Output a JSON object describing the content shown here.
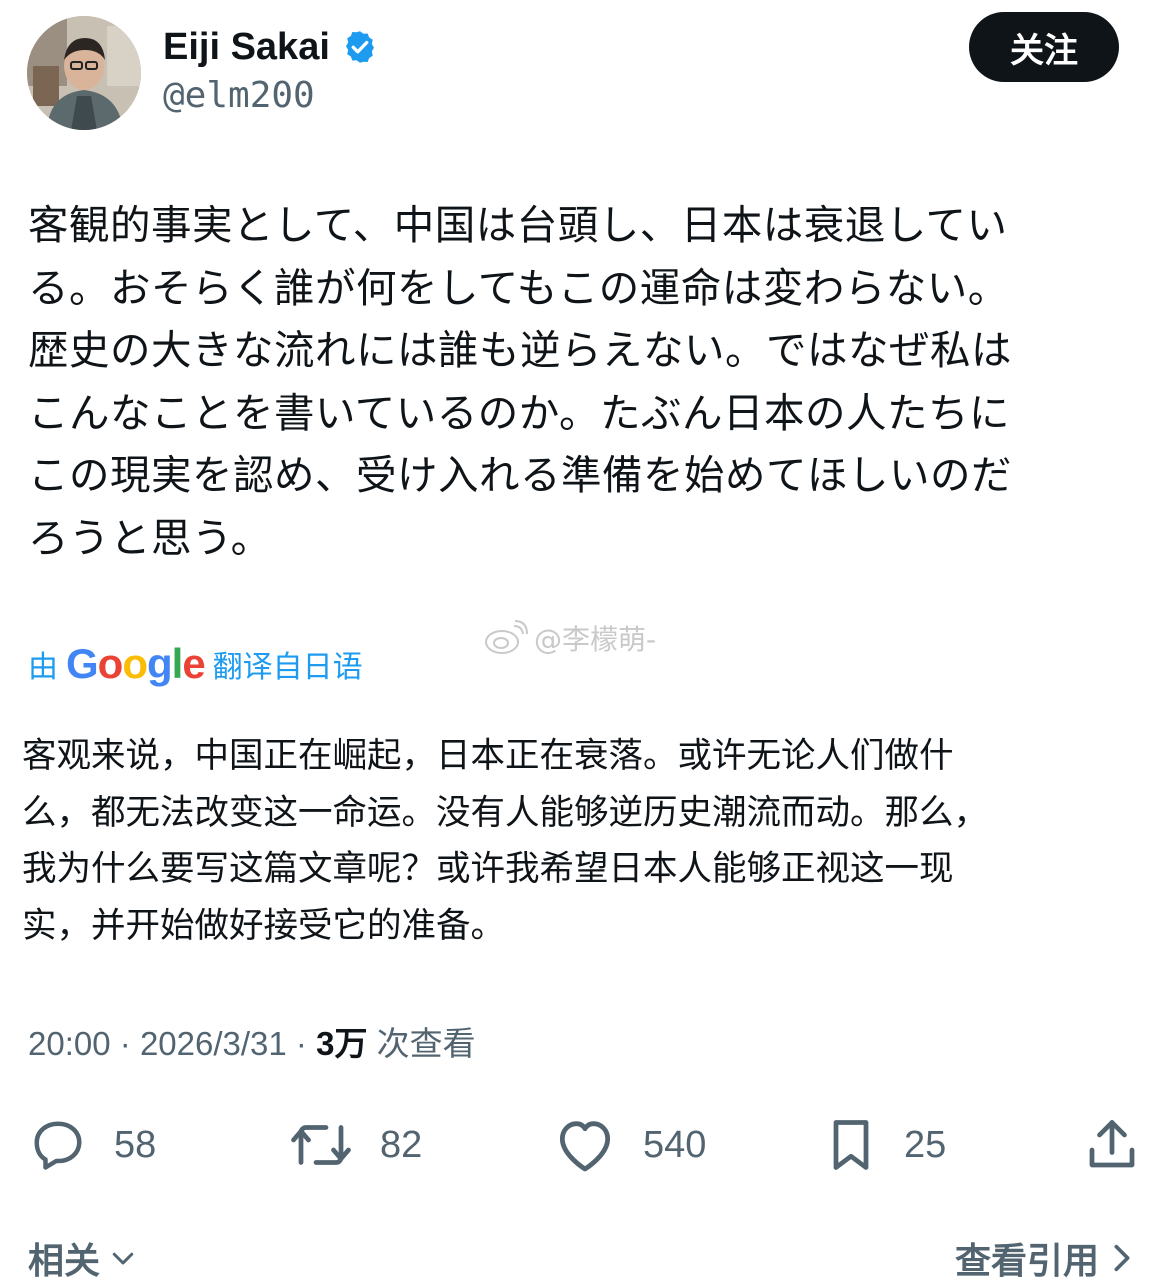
{
  "author": {
    "display_name": "Eiji Sakai",
    "handle": "@elm200",
    "verified_icon": "verified-badge-icon",
    "avatar_icon": "user-avatar"
  },
  "follow_label": "关注",
  "post": {
    "original_text": "客観的事実として、中国は台頭し、日本は衰退してい\nる。おそらく誰が何をしてもこの運命は変わらない。\n歴史の大きな流れには誰も逆らえない。ではなぜ私は\nこんなことを書いているのか。たぶん日本の人たちに\nこの現実を認め、受け入れる準備を始めてほしいのだ\nろうと思う。",
    "translation_prefix": "由",
    "translation_brand": "Google",
    "translation_suffix": "翻译自日语",
    "translated_text": "客观来说，中国正在崛起，日本正在衰落。或许无论人们做什\n么，都无法改变这一命运。没有人能够逆历史潮流而动。那么，\n我为什么要写这篇文章呢？或许我希望日本人能够正视这一现\n实，并开始做好接受它的准备。",
    "time": "20:00",
    "date": "2026/3/31",
    "views_count": "3万",
    "views_label": "次查看"
  },
  "watermark": {
    "text": "@李檬萌-",
    "icon": "weibo-icon"
  },
  "actions": {
    "replies": "58",
    "reposts": "82",
    "likes": "540",
    "bookmarks": "25"
  },
  "footer": {
    "related_label": "相关",
    "quotes_label": "查看引用"
  },
  "colors": {
    "text_primary": "#0f1419",
    "text_secondary": "#536471",
    "accent": "#1d9bf0",
    "button_bg": "#0f1419"
  }
}
